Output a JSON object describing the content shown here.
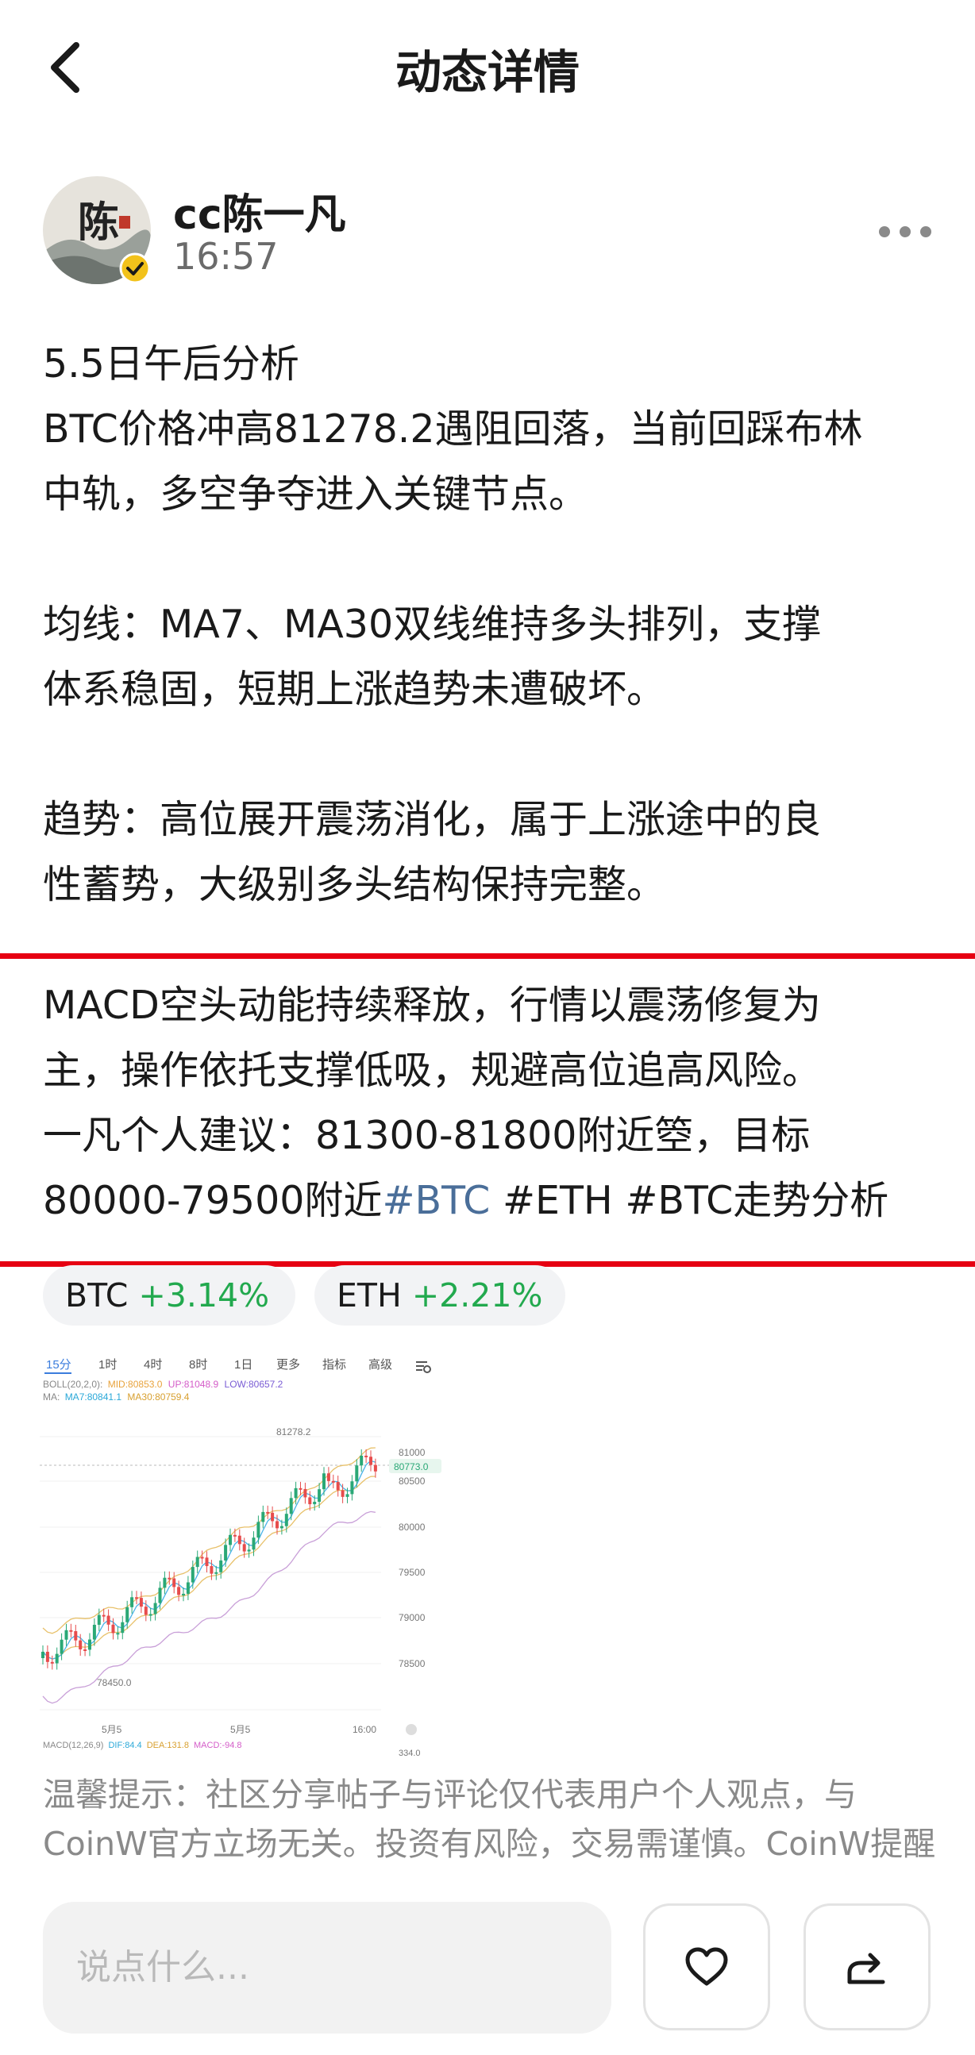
{
  "header": {
    "title": "动态详情",
    "back_icon": "chevron-left-icon"
  },
  "author": {
    "name": "cc陈一凡",
    "time": "16:57",
    "avatar_text": "陈",
    "verified_icon": "verified-check-icon",
    "more_icon": "more-dots-icon"
  },
  "post": {
    "lines_a": [
      "5.5日午后分析",
      "BTC价格冲高81278.2遇阻回落，当前回踩布林",
      "中轨，多空争夺进入关键节点。",
      "",
      " 均线：MA7、MA30双线维持多头排列，支撑",
      "体系稳固，短期上涨趋势未遭破坏。",
      "",
      " 趋势：高位展开震荡消化，属于上涨途中的良",
      "性蓄势，大级别多头结构保持完整。"
    ],
    "lines_b": [
      "MACD空头动能持续释放，行情以震荡修复为",
      "主，操作依托支撑低吸，规避高位追高风险。",
      "一凡个人建议：81300-81800附近箜，目标"
    ],
    "last_line_prefix": "80000-79500附近",
    "tags": [
      "#BTC",
      "#ETH",
      "#BTC走势分析"
    ]
  },
  "coins": [
    {
      "symbol": "BTC",
      "change": "+3.14%"
    },
    {
      "symbol": "ETH",
      "change": "+2.21%"
    }
  ],
  "chart": {
    "intervals": [
      "15分",
      "1时",
      "4时",
      "8时",
      "1日",
      "更多",
      "指标",
      "高级"
    ],
    "active_interval": "15分",
    "boll_label": "BOLL(20,2,0):",
    "boll_mid": "MID:80853.0",
    "boll_up": "UP:81048.9",
    "boll_low": "LOW:80657.2",
    "ma_label": "MA:",
    "ma7": "MA7:80841.1",
    "ma30": "MA30:80759.4",
    "high_label": "81278.2",
    "low_label": "78450.0",
    "price_ticks": [
      "81000",
      "80500",
      "80000",
      "79500",
      "79000",
      "78500"
    ],
    "current_price": "80773.0",
    "time_ticks": [
      "5月5",
      "5月5",
      "16:00"
    ],
    "macd_label": "MACD(12,26,9)",
    "macd_dif": "DIF:84.4",
    "macd_dea": "DEA:131.8",
    "macd_val": "MACD:-94.8",
    "macd_axis": "334.0",
    "colors": {
      "up": "#e74c4c",
      "down": "#2aa876",
      "boll": "#e8c16a",
      "ma7": "#4ab3e8",
      "ma30": "#c9a0d8"
    }
  },
  "notice": {
    "line1": "温馨提示：社区分享帖子与评论仅代表用户个人观点，与",
    "line2": "CoinW官方立场无关。投资有风险，交易需谨慎。CoinW提醒"
  },
  "bottom": {
    "comment_placeholder": "说点什么...",
    "like_icon": "heart-icon",
    "share_icon": "share-icon"
  }
}
